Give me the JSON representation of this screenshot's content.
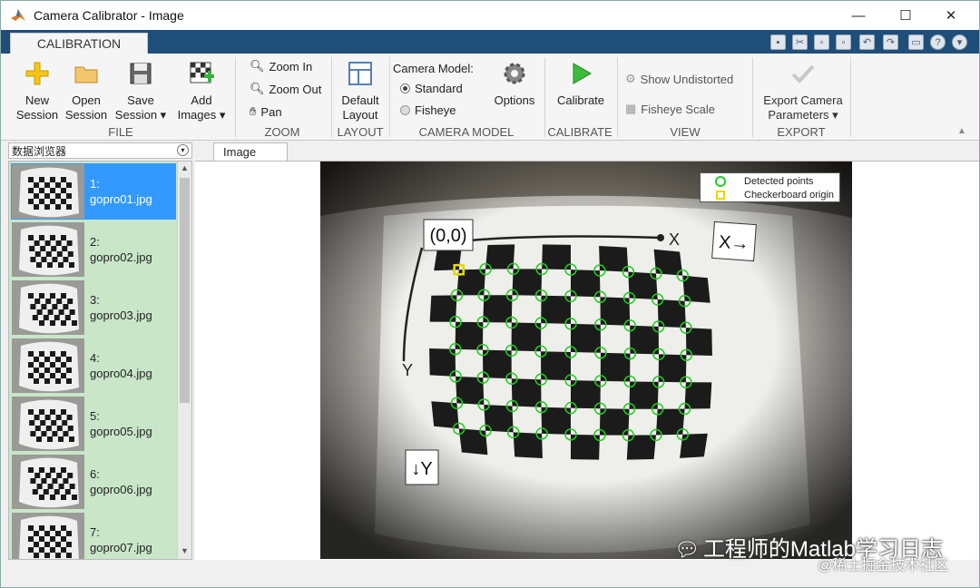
{
  "window": {
    "title": "Camera Calibrator - Image",
    "minimize": "—",
    "maximize": "☐",
    "close": "✕"
  },
  "tabs": {
    "calibration": "CALIBRATION"
  },
  "ribbon": {
    "file": {
      "label": "FILE",
      "new_session": [
        "New",
        "Session"
      ],
      "open_session": [
        "Open",
        "Session"
      ],
      "save_session": [
        "Save",
        "Session ▾"
      ],
      "add_images": [
        "Add",
        "Images ▾"
      ]
    },
    "zoom": {
      "label": "ZOOM",
      "zoom_in": "Zoom In",
      "zoom_out": "Zoom Out",
      "pan": "Pan"
    },
    "layout": {
      "label": "LAYOUT",
      "default_layout": [
        "Default",
        "Layout"
      ]
    },
    "camera_model": {
      "label": "CAMERA MODEL",
      "title": "Camera Model:",
      "standard": "Standard",
      "fisheye": "Fisheye",
      "options": "Options"
    },
    "calibrate": {
      "label": "CALIBRATE",
      "button": "Calibrate"
    },
    "view": {
      "label": "VIEW",
      "show_undistorted": "Show Undistorted",
      "fisheye_scale": "Fisheye Scale"
    },
    "export": {
      "label": "EXPORT",
      "button": [
        "Export Camera",
        "Parameters ▾"
      ]
    }
  },
  "browser": {
    "title": "数据浏览器",
    "items": [
      {
        "index": "1:",
        "file": "gopro01.jpg"
      },
      {
        "index": "2:",
        "file": "gopro02.jpg"
      },
      {
        "index": "3:",
        "file": "gopro03.jpg"
      },
      {
        "index": "4:",
        "file": "gopro04.jpg"
      },
      {
        "index": "5:",
        "file": "gopro05.jpg"
      },
      {
        "index": "6:",
        "file": "gopro06.jpg"
      },
      {
        "index": "7:",
        "file": "gopro07.jpg"
      }
    ],
    "selected_index": 0
  },
  "image_panel": {
    "tab": "Image",
    "origin_label": "(0,0)",
    "x_axis": "X",
    "x_arrow": "X→",
    "y_axis": "Y",
    "y_arrow": "↓Y",
    "legend": {
      "detected": "Detected points",
      "origin": "Checkerboard origin"
    },
    "colors": {
      "detected": "#22cc22",
      "origin": "#e6d800"
    }
  },
  "watermark": {
    "line1": "工程师的Matlab学习日志",
    "line2": "@稀土掘金技术社区"
  }
}
